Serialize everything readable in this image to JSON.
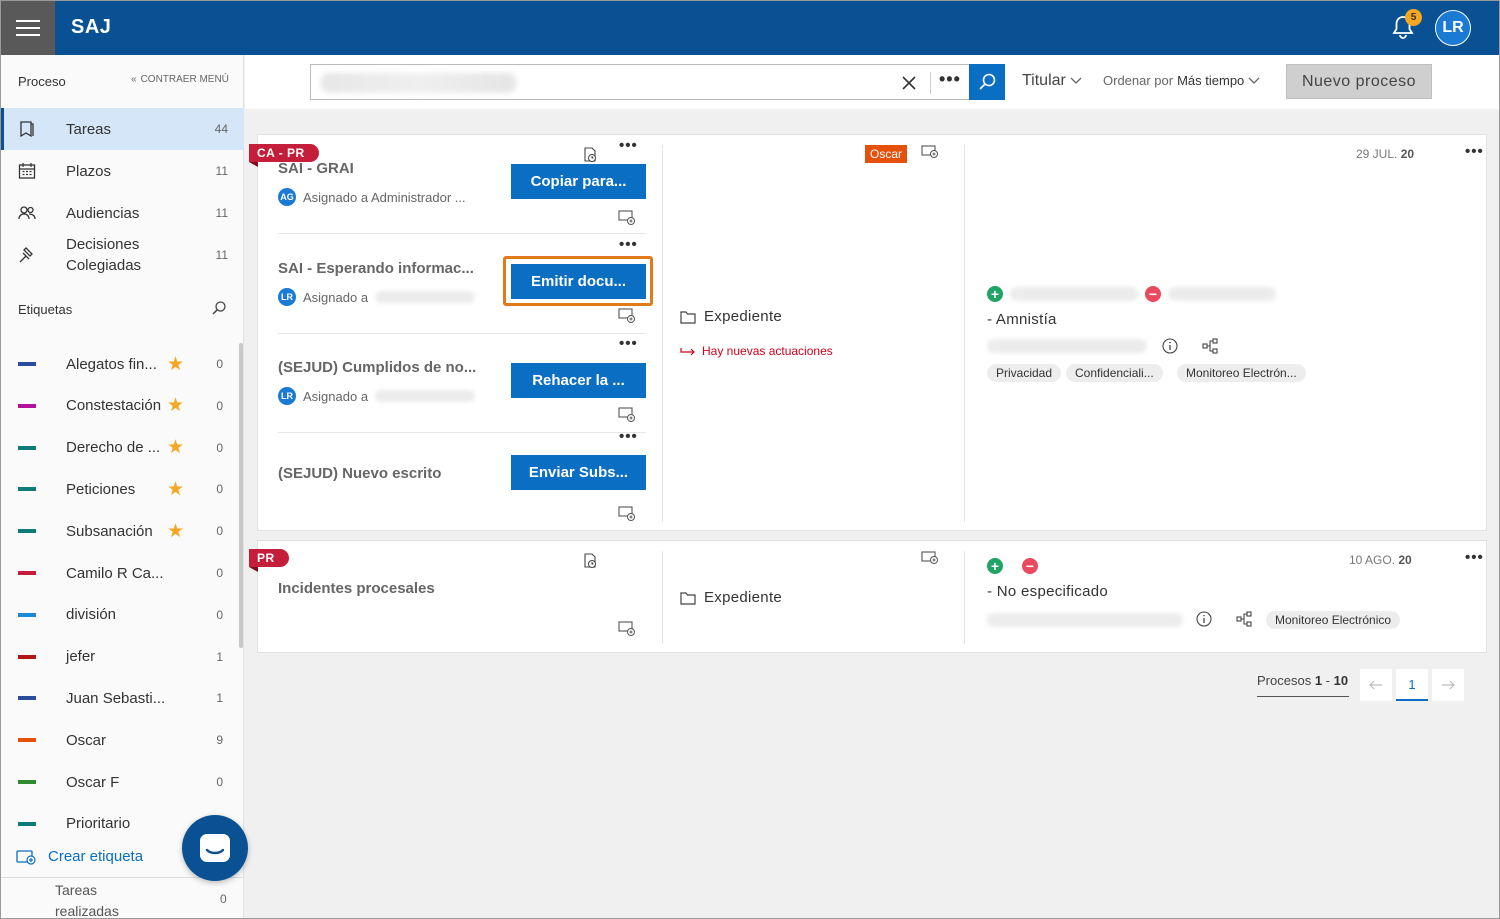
{
  "header": {
    "brand": "SAJ",
    "notifications_count": "5",
    "user_initials": "LR"
  },
  "sidebar": {
    "heading": "Proceso",
    "collapse_label": "CONTRAER MENÚ",
    "nav": [
      {
        "label": "Tareas",
        "count": "44",
        "icon": "bookmark-icon",
        "active": true
      },
      {
        "label": "Plazos",
        "count": "11",
        "icon": "calendar-icon"
      },
      {
        "label": "Audiencias",
        "count": "11",
        "icon": "people-icon"
      },
      {
        "label": "Decisiones Colegiadas",
        "count": "11",
        "icon": "gavel-icon"
      }
    ],
    "tags_heading": "Etiquetas",
    "tags": [
      {
        "label": "Alegatos fin...",
        "count": "0",
        "color": "#2b4c9b",
        "starred": true
      },
      {
        "label": "Constestación",
        "count": "0",
        "color": "#b4119a",
        "starred": true
      },
      {
        "label": "Derecho de ...",
        "count": "0",
        "color": "#0e7a7a",
        "starred": true
      },
      {
        "label": "Peticiones",
        "count": "0",
        "color": "#0e7a7a",
        "starred": true
      },
      {
        "label": "Subsanación",
        "count": "0",
        "color": "#0e7a7a",
        "starred": true
      },
      {
        "label": "Camilo R Ca...",
        "count": "0",
        "color": "#c41e3a",
        "starred": false
      },
      {
        "label": "división",
        "count": "0",
        "color": "#1a8ad4",
        "starred": false
      },
      {
        "label": "jefer",
        "count": "1",
        "color": "#b01818",
        "starred": false
      },
      {
        "label": "Juan Sebasti...",
        "count": "1",
        "color": "#2b4c9b",
        "starred": false
      },
      {
        "label": "Oscar",
        "count": "9",
        "color": "#e5500b",
        "starred": false
      },
      {
        "label": "Oscar F",
        "count": "0",
        "color": "#2e8b2e",
        "starred": false
      },
      {
        "label": "Prioritario",
        "count": "",
        "color": "#0e7a7a",
        "starred": false
      }
    ],
    "create_tag": "Crear etiqueta",
    "done_label": "Tareas realizadas",
    "done_count": "0"
  },
  "toolbar": {
    "more": "•••",
    "titular": "Titular",
    "order_prefix": "Ordenar por",
    "order_value": "Más tiempo",
    "new_process": "Nuevo proceso"
  },
  "cards": [
    {
      "ribbon": "CA - PR",
      "tasks": [
        {
          "title": "SAI - GRAI",
          "avatar": "AG",
          "assigned": "Asignado a Administrador ...",
          "action": "Copiar para..."
        },
        {
          "title": "SAI - Esperando informac...",
          "avatar": "LR",
          "assigned": "Asignado a",
          "action": "Emitir docu..."
        },
        {
          "title": "(SEJUD) Cumplidos de no...",
          "avatar": "LR",
          "assigned": "Asignado a",
          "action": "Rehacer la ..."
        },
        {
          "title": "(SEJUD) Nuevo escrito",
          "avatar": "",
          "assigned": "",
          "action": "Enviar Subs..."
        }
      ],
      "tag": "Oscar",
      "expediente": "Expediente",
      "news": "Hay nuevas actuaciones",
      "date": "29 JUL.",
      "date_year": "20",
      "party": "- Amnistía",
      "pills": [
        "Privacidad",
        "Confidenciali...",
        "Monitoreo Electrón..."
      ]
    },
    {
      "ribbon": "PR",
      "tasks": [
        {
          "title": "Incidentes procesales"
        }
      ],
      "expediente": "Expediente",
      "date": "10 AGO.",
      "date_year": "20",
      "party": "- No especificado",
      "pills": [
        "Monitoreo Electrónico"
      ]
    }
  ],
  "pagination": {
    "label": "Procesos",
    "from": "1",
    "to": "10",
    "current_page": "1"
  }
}
